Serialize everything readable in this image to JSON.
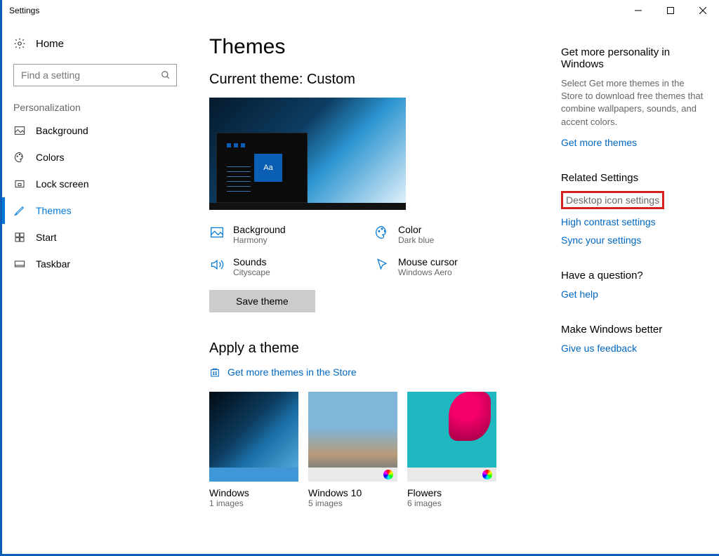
{
  "window": {
    "title": "Settings"
  },
  "sidebar": {
    "home": "Home",
    "search_placeholder": "Find a setting",
    "section": "Personalization",
    "items": [
      {
        "label": "Background"
      },
      {
        "label": "Colors"
      },
      {
        "label": "Lock screen"
      },
      {
        "label": "Themes"
      },
      {
        "label": "Start"
      },
      {
        "label": "Taskbar"
      }
    ]
  },
  "main": {
    "title": "Themes",
    "current_heading": "Current theme: Custom",
    "preview_tile": "Aa",
    "parts": {
      "bg_title": "Background",
      "bg_val": "Harmony",
      "color_title": "Color",
      "color_val": "Dark blue",
      "sound_title": "Sounds",
      "sound_val": "Cityscape",
      "cursor_title": "Mouse cursor",
      "cursor_val": "Windows Aero"
    },
    "save": "Save theme",
    "apply_heading": "Apply a theme",
    "store_link": "Get more themes in the Store",
    "themes": [
      {
        "name": "Windows",
        "count": "1 images"
      },
      {
        "name": "Windows 10",
        "count": "5 images"
      },
      {
        "name": "Flowers",
        "count": "6 images"
      }
    ]
  },
  "right": {
    "block1_heading": "Get more personality in Windows",
    "block1_desc": "Select Get more themes in the Store to download free themes that combine wallpapers, sounds, and accent colors.",
    "block1_link": "Get more themes",
    "related_heading": "Related Settings",
    "desktop_icon": "Desktop icon settings",
    "high_contrast": "High contrast settings",
    "sync": "Sync your settings",
    "question_heading": "Have a question?",
    "get_help": "Get help",
    "better_heading": "Make Windows better",
    "feedback": "Give us feedback"
  }
}
